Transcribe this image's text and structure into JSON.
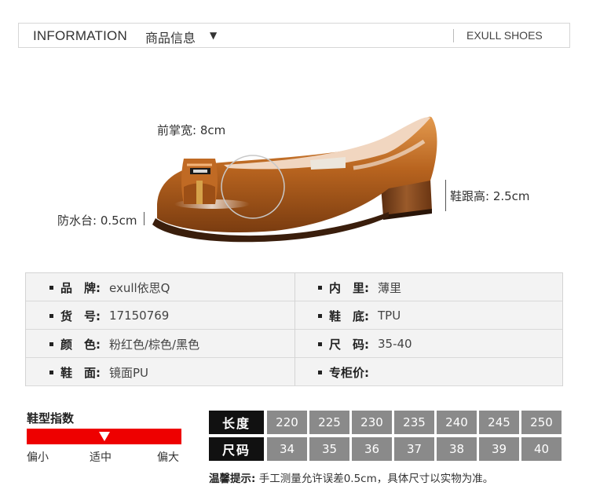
{
  "header": {
    "title_en": "INFORMATION",
    "title_cn": "商品信息",
    "arrow": "▼",
    "brand": "EXULL SHOES"
  },
  "annotations": {
    "forefoot": "前掌宽: 8cm",
    "heel": "鞋跟高: 2.5cm",
    "platform": "防水台: 0.5cm"
  },
  "specs": {
    "left": [
      {
        "label": "品　牌:",
        "value": "exull依思Q"
      },
      {
        "label": "货　号:",
        "value": "17150769"
      },
      {
        "label": "颜　色:",
        "value": "粉红色/棕色/黑色"
      },
      {
        "label": "鞋　面:",
        "value": "镜面PU"
      }
    ],
    "right": [
      {
        "label": "内　里:",
        "value": "薄里"
      },
      {
        "label": "鞋　底:",
        "value": "TPU"
      },
      {
        "label": "尺　码:",
        "value": "35-40"
      },
      {
        "label": "专柜价:",
        "value": ""
      }
    ]
  },
  "fit_guide": {
    "title": "鞋型指数",
    "labels": [
      "偏小",
      "适中",
      "偏大"
    ],
    "level": 0.5,
    "bar_color": "#ee0000"
  },
  "size_chart": {
    "length_label": "长度",
    "size_label": "尺码",
    "lengths": [
      "220",
      "225",
      "230",
      "235",
      "240",
      "245",
      "250"
    ],
    "sizes": [
      "34",
      "35",
      "36",
      "37",
      "38",
      "39",
      "40"
    ]
  },
  "note": {
    "prefix": "温馨提示:",
    "text": "手工测量允许误差0.5cm，具体尺寸以实物为准。"
  }
}
